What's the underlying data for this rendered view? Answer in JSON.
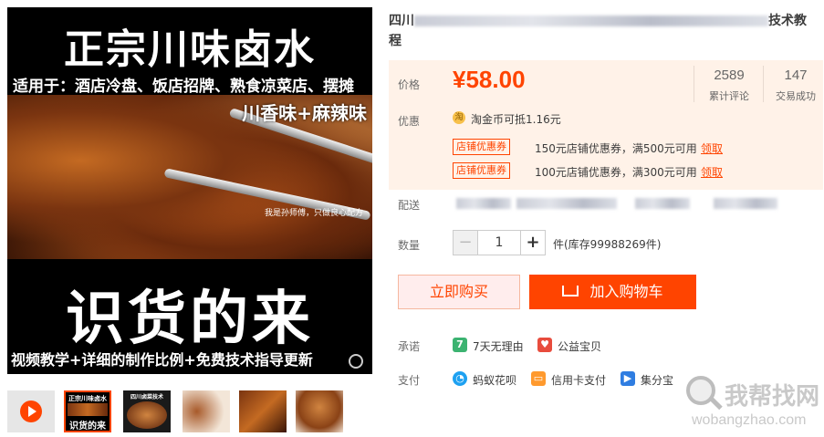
{
  "main_image": {
    "title": "正宗川味卤水",
    "suitable": "适用于：酒店冷盘、饭店招牌、熟食凉菜店、摆摊",
    "flavor": "川香味+麻辣味",
    "note": "我是孙师傅，只做良心配方",
    "big": "识货的来",
    "footer": "视频教学+详细的制作比例+免费技术指导更新"
  },
  "thumbnails": [
    {
      "name": "video",
      "selected": false,
      "lines": []
    },
    {
      "name": "poster",
      "selected": true,
      "lines": [
        "正宗川味卤水",
        "识货的来"
      ]
    },
    {
      "name": "poster-2",
      "selected": false,
      "lines": [
        "四川卤菜技术"
      ]
    },
    {
      "name": "dish-1",
      "selected": false,
      "lines": []
    },
    {
      "name": "dish-2",
      "selected": false,
      "lines": []
    },
    {
      "name": "dish-3",
      "selected": false,
      "lines": []
    }
  ],
  "product": {
    "title_start": "四川",
    "title_end": "技术教",
    "title_line2": "程"
  },
  "price": {
    "label": "价格",
    "value": "¥58.00",
    "reviews_count": "2589",
    "reviews_label": "累计评论",
    "sales_count": "147",
    "sales_label": "交易成功"
  },
  "promo": {
    "label": "优惠",
    "coin_icon": "淘",
    "coin_text": "淘金币可抵1.16元",
    "coupons": [
      {
        "tag": "店铺优惠券",
        "text": "150元店铺优惠券，满500元可用",
        "action": "领取"
      },
      {
        "tag": "店铺优惠券",
        "text": "100元店铺优惠券，满300元可用",
        "action": "领取"
      }
    ]
  },
  "delivery": {
    "label": "配送"
  },
  "quantity": {
    "label": "数量",
    "minus": "−",
    "value": "1",
    "plus": "+",
    "stock": "件(库存99988269件)"
  },
  "buttons": {
    "buy_now": "立即购买",
    "add_cart": "加入购物车"
  },
  "promise": {
    "label": "承诺",
    "items": [
      {
        "icon": "7",
        "text": "7天无理由",
        "color": "#3cb371"
      },
      {
        "icon": "♥",
        "text": "公益宝贝",
        "color": "#e84c3d"
      }
    ]
  },
  "payment": {
    "label": "支付",
    "items": [
      {
        "icon": "◔",
        "text": "蚂蚁花呗",
        "color": "#1ea1f1"
      },
      {
        "icon": "▭",
        "text": "信用卡支付",
        "color": "#ff9a2e"
      },
      {
        "icon": "▶",
        "text": "集分宝",
        "color": "#2f7de1"
      }
    ]
  },
  "watermark": {
    "cn": "我帮找网",
    "url": "wobangzhao.com"
  },
  "colors": {
    "accent": "#ff4400",
    "price_bg": "#fff2e8"
  }
}
